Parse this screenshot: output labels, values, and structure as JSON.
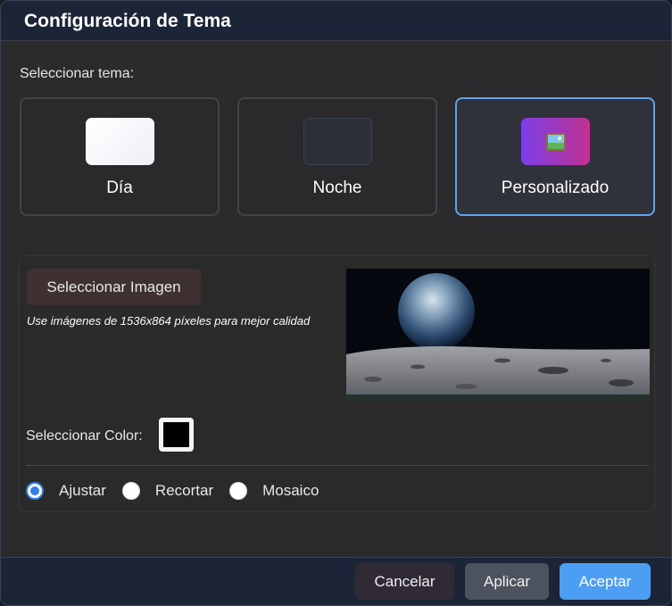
{
  "dialog": {
    "title": "Configuración de Tema"
  },
  "theme_section": {
    "label": "Seleccionar tema:",
    "options": [
      {
        "label": "Día",
        "selected": false
      },
      {
        "label": "Noche",
        "selected": false
      },
      {
        "label": "Personalizado",
        "selected": true
      }
    ]
  },
  "custom_panel": {
    "select_image_label": "Seleccionar Imagen",
    "hint": "Use imágenes de 1536x864 píxeles para mejor calidad",
    "color_label": "Seleccionar Color:",
    "selected_color": "#000000",
    "fit_options": [
      {
        "label": "Ajustar",
        "checked": true
      },
      {
        "label": "Recortar",
        "checked": false
      },
      {
        "label": "Mosaico",
        "checked": false
      }
    ]
  },
  "footer": {
    "cancel_label": "Cancelar",
    "apply_label": "Aplicar",
    "accept_label": "Aceptar"
  },
  "colors": {
    "accent": "#4c9ef2",
    "selected_border": "#5fa2ee",
    "titlebar": "#1c2437"
  }
}
